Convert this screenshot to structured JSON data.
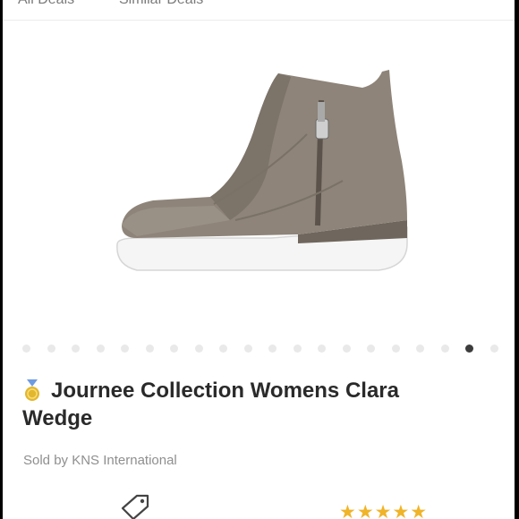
{
  "tabs": {
    "all_deals": "All Deals",
    "similar_deals": "Similar Deals"
  },
  "product": {
    "title_line1": "Journee Collection Womens Clara",
    "title_line2": "Wedge",
    "sold_by": "Sold by KNS International",
    "rating_stars": "★★★★★",
    "image_index": 18,
    "image_count": 20
  },
  "colors": {
    "accent_star": "#f0b42a",
    "medal": "#e3b72d",
    "shoe": "#8e8479"
  },
  "icons": {
    "medal": "medal-icon",
    "tag": "price-tag-icon"
  }
}
